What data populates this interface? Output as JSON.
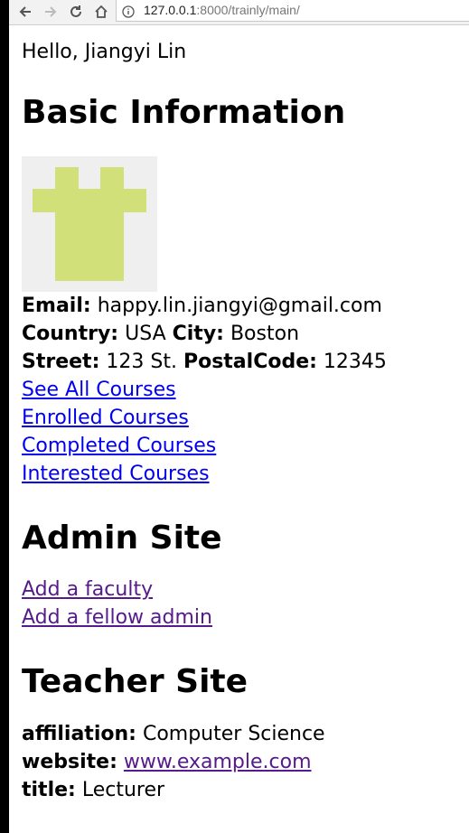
{
  "browser": {
    "url_host": "127.0.0.1",
    "url_rest": ":8000/trainly/main/"
  },
  "greeting": "Hello, Jiangyi Lin",
  "basic": {
    "heading": "Basic Information",
    "email_label": "Email:",
    "email": "happy.lin.jiangyi@gmail.com",
    "country_label": "Country:",
    "country": "USA",
    "city_label": "City:",
    "city": "Boston",
    "street_label": "Street:",
    "street": "123 St.",
    "postal_label": "PostalCode:",
    "postal": "12345",
    "links": [
      "See All Courses",
      "Enrolled Courses",
      "Completed Courses",
      "Interested Courses"
    ]
  },
  "admin": {
    "heading": "Admin Site",
    "links": [
      "Add a faculty",
      "Add a fellow admin"
    ]
  },
  "teacher": {
    "heading": "Teacher Site",
    "affiliation_label": "affiliation:",
    "affiliation": "Computer Science",
    "website_label": "website:",
    "website": "www.example.com",
    "title_label": "title:",
    "title": "Lecturer"
  },
  "colors": {
    "avatar_bg": "#efefef",
    "avatar_fg": "#d2e079",
    "link": "#0000ee",
    "visited_link": "#551a8b"
  }
}
